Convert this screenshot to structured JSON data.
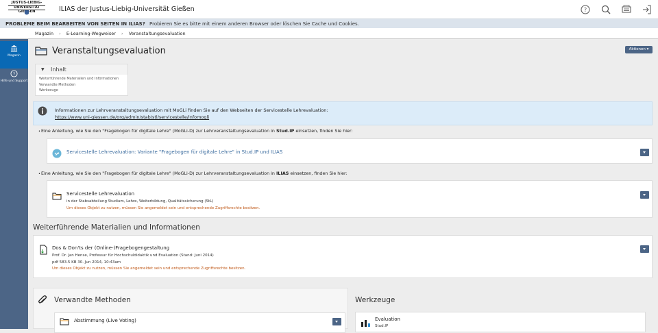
{
  "logo": {
    "lines": [
      "JUSTUS-LIEBIG-",
      "UNIVERSITÄT",
      "GIESSEN"
    ]
  },
  "header": {
    "title": "ILIAS der Justus-Liebig-Universität Gießen"
  },
  "notice": {
    "strong": "PROBLEME BEIM BEARBEITEN VON SEITEN IN ILIAS?",
    "text": "Probieren Sie es bitte mit einem anderen Browser oder löschen Sie Cache und Cookies."
  },
  "breadcrumb": [
    "Magazin",
    "E-Learning-Wegweiser",
    "Veranstaltungsevaluation"
  ],
  "sidebar": {
    "items": [
      {
        "label": "Magazin",
        "icon": "building-icon"
      },
      {
        "label": "Hilfe und Support",
        "icon": "help-icon"
      }
    ]
  },
  "page": {
    "title": "Veranstaltungsevaluation",
    "actions_label": "Aktionen"
  },
  "toc": {
    "heading": "Inhalt",
    "items": [
      "Weiterführende Materialien und Informationen",
      "Verwandte Methoden",
      "Werkzeuge"
    ]
  },
  "info": {
    "text": "Informationen zur Lehrveranstaltungsevaluation mit MoGLi finden Sie auf den Webseiten der Servicestelle Lehrevaluation:",
    "link": "https://www.uni-giessen.de/org/admin/stab/stl/servicestelle/infomogli"
  },
  "bullets": [
    {
      "pre": "Eine Anleitung, wie Sie den \"Fragebogen für digitale Lehre\" (MoGLi-D) zur Lehrveranstaltungsevaluation in ",
      "strong": "Stud.IP",
      "post": " einsetzen, finden Sie hier:"
    },
    {
      "pre": "Eine Anleitung, wie Sie den \"Fragebogen für digitale Lehre\" (MoGLi-D) zur Lehrveranstaltungsevaluation in ",
      "strong": "ILIAS",
      "post": " einsetzen, finden Sie hier:"
    }
  ],
  "link_item": {
    "title": "Servicestelle Lehrevaluation: Variante \"Fragebogen für digitale Lehre\" in Stud.IP und ILIAS"
  },
  "folder_item": {
    "title": "Servicestelle Lehrevaluation",
    "sub": "in der Stabsabteilung Studium, Lehre, Weiterbildung, Qualitätssicherung (StL)",
    "warn": "Um dieses Objekt zu nutzen, müssen Sie angemeldet sein und entsprechende Zugriffsrechte besitzen."
  },
  "section_materials": "Weiterführende Materialien und Informationen",
  "file_item": {
    "title": "Dos & Don'ts der (Online-)Fragebogengestaltung",
    "sub": "Prof. Dr. Jan Hense, Professur für Hochschuldidaktik und Evaluation (Stand: Juni 2014)",
    "meta": "pdf   583.5 KB   30. Jun 2014, 10:43am",
    "warn": "Um dieses Objekt zu nutzen, müssen Sie angemeldet sein und entsprechende Zugriffsrechte besitzen."
  },
  "section_methods": "Verwandte Methoden",
  "method_item": {
    "title": "Abstimmung (Live Voting)"
  },
  "section_tools": "Werkzeuge",
  "tool_item": {
    "title": "Evaluation",
    "sub": "Stud.IP"
  },
  "colors": {
    "sidebar": "#4c6586",
    "active": "#0a69b5",
    "button": "#4c6586",
    "info_bg": "#dcecf9",
    "warn": "#c05a1a"
  }
}
